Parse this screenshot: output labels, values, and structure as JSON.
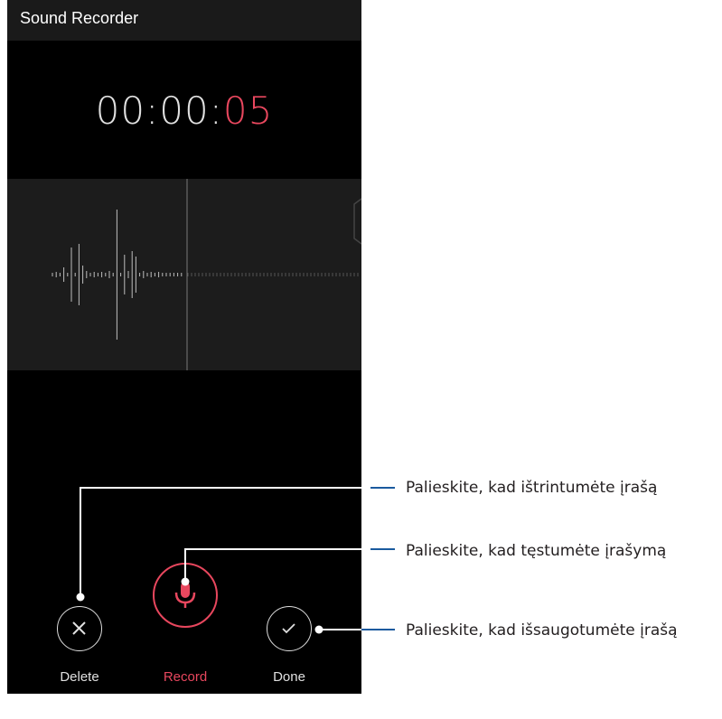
{
  "app": {
    "title": "Sound Recorder"
  },
  "timer": {
    "prefix": "00:00:",
    "seconds": "05"
  },
  "controls": {
    "delete_label": "Delete",
    "record_label": "Record",
    "done_label": "Done"
  },
  "callouts": [
    "Palieskite, kad ištrintumėte įrašą",
    "Palieskite, kad tęstumėte įrašymą",
    "Palieskite, kad išsaugotumėte įrašą"
  ],
  "colors": {
    "accent": "#e8475e",
    "background": "#000000",
    "wave_bg": "#1c1c1c",
    "callout_line": "#1a5a9e"
  }
}
